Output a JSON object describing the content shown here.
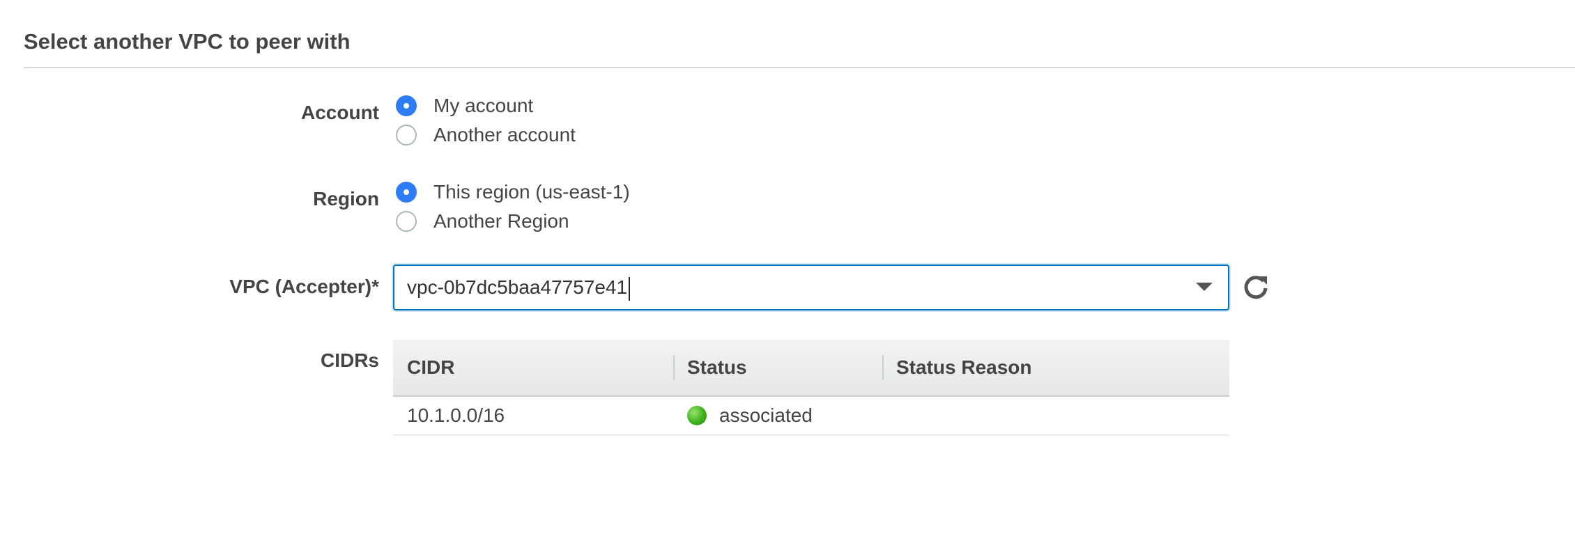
{
  "section": {
    "title": "Select another VPC to peer with"
  },
  "account": {
    "label": "Account",
    "options": [
      {
        "label": "My account",
        "selected": true
      },
      {
        "label": "Another account",
        "selected": false
      }
    ]
  },
  "region": {
    "label": "Region",
    "options": [
      {
        "label": "This region (us-east-1)",
        "selected": true
      },
      {
        "label": "Another Region",
        "selected": false
      }
    ]
  },
  "vpc": {
    "label": "VPC (Accepter)*",
    "value": "vpc-0b7dc5baa47757e41"
  },
  "cidrs": {
    "label": "CIDRs",
    "columns": [
      "CIDR",
      "Status",
      "Status Reason"
    ],
    "rows": [
      {
        "cidr": "10.1.0.0/16",
        "status": "associated",
        "status_reason": ""
      }
    ]
  },
  "colors": {
    "accent": "#2e7cf6",
    "focus_border": "#0073bb",
    "status_ok": "#3cb11b"
  },
  "icons": {
    "refresh": "refresh-icon",
    "dropdown": "chevron-down-icon",
    "status": "status-dot-icon"
  }
}
